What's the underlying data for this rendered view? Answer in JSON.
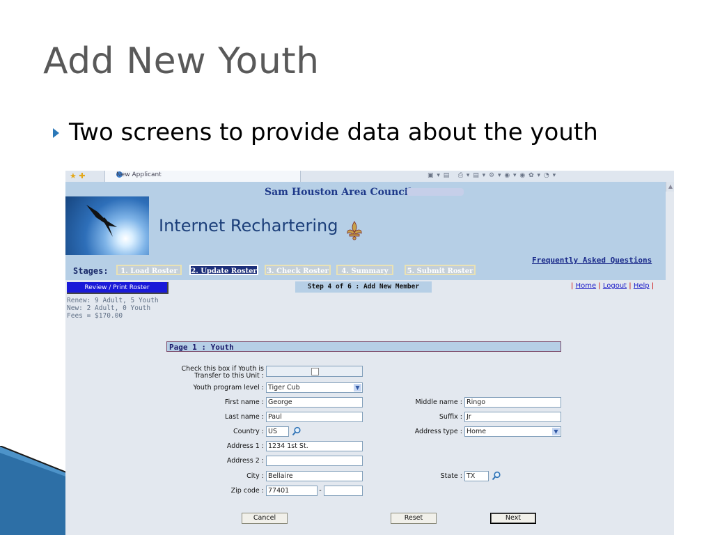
{
  "slide": {
    "title": "Add New Youth",
    "bullet": "Two screens to provide data about the youth"
  },
  "browser": {
    "tab_title": "New Applicant"
  },
  "header": {
    "council": "Sam Houston Area Council:",
    "app_title": "Internet Rechartering",
    "faq": "Frequently Asked Questions"
  },
  "stages": {
    "label": "Stages:",
    "items": [
      {
        "label": "1. Load Roster",
        "active": false
      },
      {
        "label": "2. Update Roster",
        "active": true
      },
      {
        "label": "3. Check Roster",
        "active": false
      },
      {
        "label": "4. Summary",
        "active": false
      },
      {
        "label": "5. Submit Roster",
        "active": false
      }
    ]
  },
  "sidebar": {
    "review_button": "Review / Print Roster",
    "renew": "Renew: 9 Adult, 5 Youth",
    "new": "New: 2 Adult, 0 Youth",
    "fees": "Fees = $170.00"
  },
  "step": "Step 4 of 6 : Add New Member",
  "links": {
    "home": "Home",
    "logout": "Logout",
    "help": "Help",
    "sep": "|"
  },
  "form": {
    "page_heading": "Page 1 : Youth",
    "transfer_label_1": "Check this box if Youth is",
    "transfer_label_2": "Transfer to this Unit :",
    "program_level_label": "Youth program level :",
    "program_level_value": "Tiger Cub",
    "first_name_label": "First name :",
    "first_name_value": "George",
    "middle_name_label": "Middle name :",
    "middle_name_value": "Ringo",
    "last_name_label": "Last name :",
    "last_name_value": "Paul",
    "suffix_label": "Suffix :",
    "suffix_value": "Jr",
    "country_label": "Country :",
    "country_value": "US",
    "address_type_label": "Address type :",
    "address_type_value": "Home",
    "address1_label": "Address 1 :",
    "address1_value": "1234 1st St.",
    "address2_label": "Address 2 :",
    "address2_value": "",
    "city_label": "City :",
    "city_value": "Bellaire",
    "state_label": "State :",
    "state_value": "TX",
    "zip_label": "Zip code :",
    "zip_value": "77401",
    "zip_ext_value": "",
    "zip_dash": "-"
  },
  "buttons": {
    "cancel": "Cancel",
    "reset": "Reset",
    "next": "Next"
  }
}
